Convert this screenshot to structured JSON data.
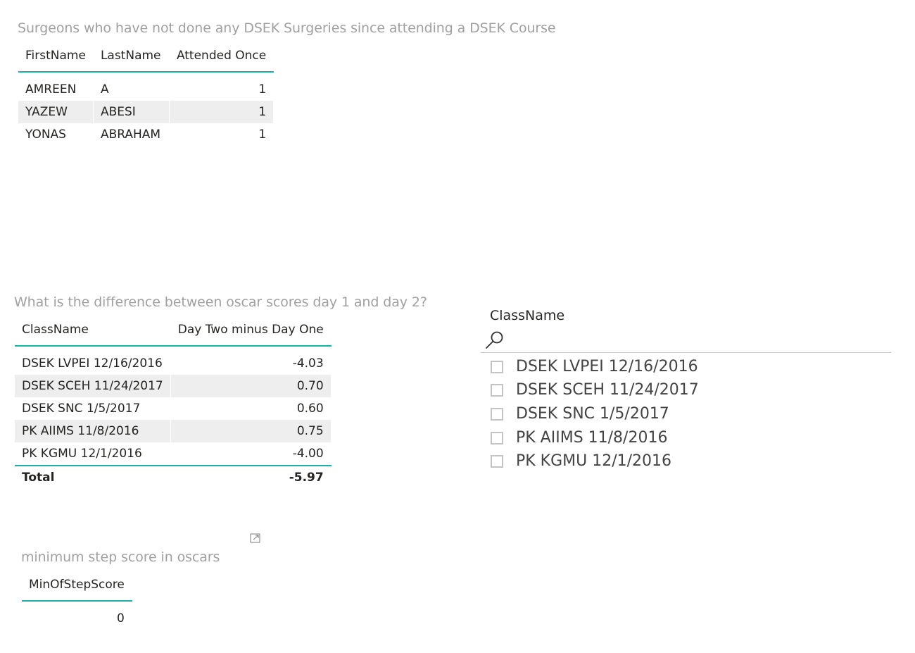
{
  "surgeons_visual": {
    "title": "Surgeons who have not done any DSEK Surgeries since attending a DSEK Course",
    "columns": [
      "FirstName",
      "LastName",
      "Attended Once"
    ],
    "rows": [
      {
        "first": "AMREEN",
        "last": "A",
        "attended": "1"
      },
      {
        "first": "YAZEW",
        "last": "ABESI",
        "attended": "1"
      },
      {
        "first": "YONAS",
        "last": "ABRAHAM",
        "attended": "1"
      }
    ]
  },
  "oscar_diff_visual": {
    "title": "What is the difference between oscar scores day 1 and day 2?",
    "columns": [
      "ClassName",
      "Day Two minus Day One"
    ],
    "rows": [
      {
        "class": "DSEK LVPEI 12/16/2016",
        "value": "-4.03"
      },
      {
        "class": "DSEK SCEH 11/24/2017",
        "value": "0.70"
      },
      {
        "class": "DSEK SNC 1/5/2017",
        "value": "0.60"
      },
      {
        "class": "PK AIIMS 11/8/2016",
        "value": "0.75"
      },
      {
        "class": "PK KGMU 12/1/2016",
        "value": "-4.00"
      }
    ],
    "total_label": "Total",
    "total_value": "-5.97"
  },
  "class_slicer": {
    "header": "ClassName",
    "search_icon": "search-icon",
    "items": [
      "DSEK LVPEI 12/16/2016",
      "DSEK SCEH 11/24/2017",
      "DSEK SNC 1/5/2017",
      "PK AIIMS 11/8/2016",
      "PK KGMU 12/1/2016"
    ]
  },
  "min_step_visual": {
    "title": "minimum step score in oscars",
    "focus_icon": "focus-mode-icon",
    "column": "MinOfStepScore",
    "value": "0"
  },
  "colors": {
    "accent": "#1ab2a2",
    "title_gray": "#a0a0a0",
    "alt_row": "#eeeeee"
  }
}
